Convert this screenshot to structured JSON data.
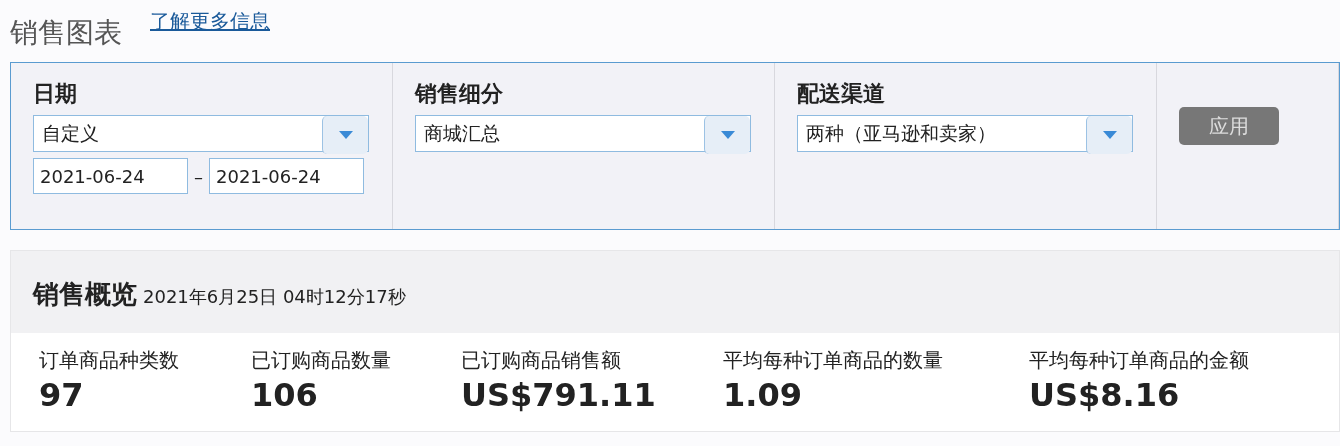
{
  "page": {
    "title": "销售图表",
    "link": "了解更多信息"
  },
  "filters": [
    {
      "kind": "date",
      "label": "日期",
      "value": "自定义",
      "from": "2021-06-24",
      "separator": "–",
      "to": "2021-06-24"
    },
    {
      "kind": "select",
      "label": "销售细分",
      "value": "商城汇总"
    },
    {
      "kind": "select",
      "label": "配送渠道",
      "value": "两种（亚马逊和卖家）"
    }
  ],
  "apply_button": {
    "label": "应用",
    "disabled": true
  },
  "summary": {
    "title": "销售概览",
    "timestamp": "2021年6月25日 04时12分17秒",
    "metrics": [
      {
        "label": "订单商品种类数",
        "value": "97"
      },
      {
        "label": "已订购商品数量",
        "value": "106"
      },
      {
        "label": "已订购商品销售额",
        "value": "US$791.11"
      },
      {
        "label": "平均每种订单商品的数量",
        "value": "1.09"
      },
      {
        "label": "平均每种订单商品的金额",
        "value": "US$8.16"
      }
    ]
  }
}
